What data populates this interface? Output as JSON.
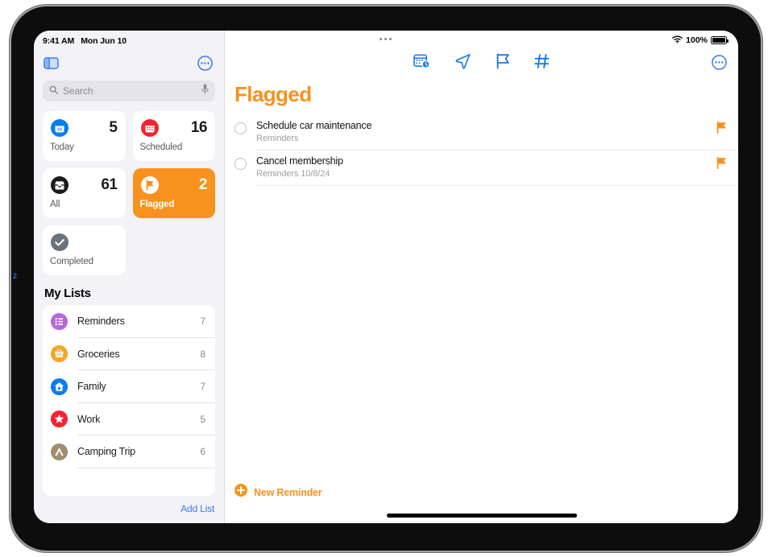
{
  "status_bar": {
    "time": "9:41 AM",
    "date": "Mon Jun 10",
    "battery_percent": "100%",
    "wifi_icon": "wifi-icon",
    "battery_icon": "battery-full-icon"
  },
  "sidebar": {
    "toggle_icon": "sidebar-toggle-icon",
    "more_icon": "more-circle-icon",
    "search": {
      "placeholder": "Search",
      "search_icon": "search-icon",
      "mic_icon": "microphone-icon"
    },
    "smart_lists": [
      {
        "label": "Today",
        "count": "5",
        "icon": "calendar-day-icon",
        "icon_color": "#0a7cf0",
        "selected": false
      },
      {
        "label": "Scheduled",
        "count": "16",
        "icon": "calendar-icon",
        "icon_color": "#f5232f",
        "selected": false
      },
      {
        "label": "All",
        "count": "61",
        "icon": "inbox-tray-icon",
        "icon_color": "#1c1c1e",
        "selected": false
      },
      {
        "label": "Flagged",
        "count": "2",
        "icon": "flag-icon",
        "icon_color": "#ffffff",
        "selected": true
      },
      {
        "label": "Completed",
        "count": "",
        "icon": "checkmark-circle-icon",
        "icon_color": "#6c727c",
        "selected": false
      }
    ],
    "my_lists_title": "My Lists",
    "lists": [
      {
        "name": "Reminders",
        "count": "7",
        "icon": "list-bullet-icon",
        "icon_color": "#b668d8"
      },
      {
        "name": "Groceries",
        "count": "8",
        "icon": "basket-icon",
        "icon_color": "#f5a623"
      },
      {
        "name": "Family",
        "count": "7",
        "icon": "house-icon",
        "icon_color": "#0a7cf0"
      },
      {
        "name": "Work",
        "count": "5",
        "icon": "star-icon",
        "icon_color": "#f5232f"
      },
      {
        "name": "Camping Trip",
        "count": "6",
        "icon": "tent-icon",
        "icon_color": "#a08e6c"
      }
    ],
    "add_list_label": "Add List"
  },
  "detail": {
    "title": "Flagged",
    "title_color": "#f7921e",
    "window_dots_icon": "window-dots-icon",
    "more_icon": "more-circle-icon",
    "toolbar": [
      {
        "icon": "calendar-clock-icon",
        "name": "add-date-button"
      },
      {
        "icon": "location-arrow-icon",
        "name": "add-location-button"
      },
      {
        "icon": "flag-icon",
        "name": "toggle-flag-button"
      },
      {
        "icon": "hashtag-icon",
        "name": "add-tag-button"
      }
    ],
    "reminders": [
      {
        "title": "Schedule car maintenance",
        "list": "Reminders",
        "date": "",
        "flagged": true
      },
      {
        "title": "Cancel membership",
        "list": "Reminders",
        "date": "10/8/24",
        "flagged": true
      }
    ],
    "new_reminder_label": "New Reminder",
    "new_reminder_icon": "plus-circle-icon"
  },
  "annotation": {
    "marker_2": "2"
  },
  "colors": {
    "accent_orange": "#f7921e",
    "accent_blue": "#3b7df0",
    "sidebar_bg": "#f2f2f7"
  }
}
